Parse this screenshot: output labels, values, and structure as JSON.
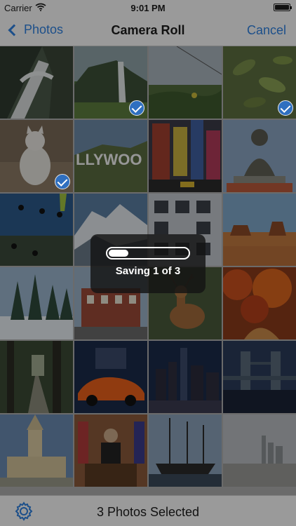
{
  "status_bar": {
    "carrier": "Carrier",
    "time": "9:01 PM"
  },
  "nav": {
    "back_label": "Photos",
    "title": "Camera Roll",
    "cancel_label": "Cancel"
  },
  "photos": [
    {
      "name": "waterfall",
      "selected": false
    },
    {
      "name": "cliff-waterfall",
      "selected": true
    },
    {
      "name": "field-sky",
      "selected": false
    },
    {
      "name": "leaves",
      "selected": true
    },
    {
      "name": "white-dog",
      "selected": true
    },
    {
      "name": "hollywood-sign",
      "selected": false
    },
    {
      "name": "times-square",
      "selected": false
    },
    {
      "name": "buddha-statue",
      "selected": false
    },
    {
      "name": "skydivers",
      "selected": false
    },
    {
      "name": "snowy-mountain",
      "selected": false
    },
    {
      "name": "building-windows",
      "selected": false
    },
    {
      "name": "desert-mesa",
      "selected": false
    },
    {
      "name": "snowy-forest",
      "selected": false
    },
    {
      "name": "brick-building",
      "selected": false
    },
    {
      "name": "deer",
      "selected": false
    },
    {
      "name": "autumn-trees",
      "selected": false
    },
    {
      "name": "forest-path",
      "selected": false
    },
    {
      "name": "orange-sports-car",
      "selected": false
    },
    {
      "name": "city-skyline-night",
      "selected": false
    },
    {
      "name": "tower-bridge",
      "selected": false
    },
    {
      "name": "church",
      "selected": false
    },
    {
      "name": "oval-office",
      "selected": false
    },
    {
      "name": "sailing-ship",
      "selected": false
    },
    {
      "name": "hazy-skyline",
      "selected": false
    }
  ],
  "hud": {
    "label": "Saving 1 of 3",
    "progress": 0.25
  },
  "toolbar": {
    "selected_label": "3 Photos Selected"
  },
  "colors": {
    "accent": "#1c4f8a",
    "check": "#2f6fc0"
  }
}
